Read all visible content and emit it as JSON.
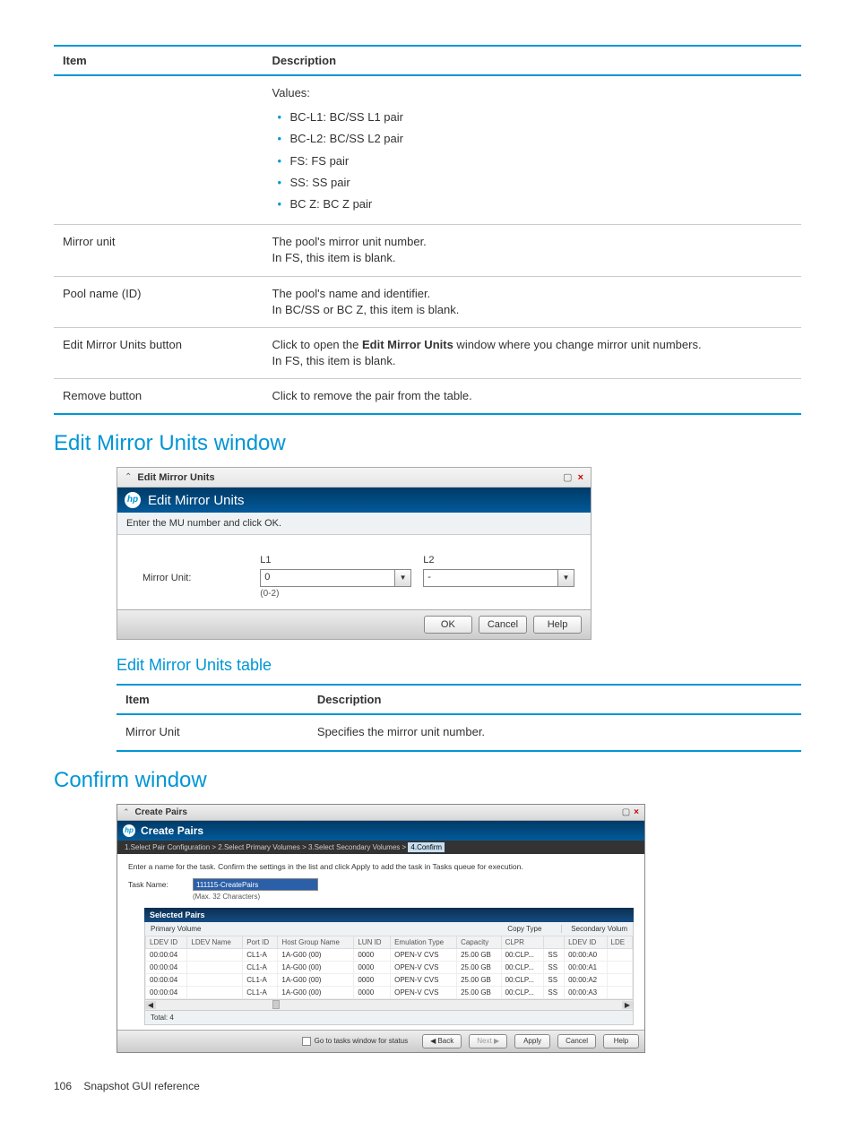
{
  "table1": {
    "headers": {
      "item": "Item",
      "desc": "Description"
    },
    "rows": {
      "r0": {
        "item": "",
        "values_label": "Values:",
        "bullets": [
          "BC-L1: BC/SS L1 pair",
          "BC-L2: BC/SS L2 pair",
          "FS: FS pair",
          "SS: SS pair",
          "BC Z: BC Z pair"
        ]
      },
      "r1": {
        "item": "Mirror unit",
        "l1": "The pool's mirror unit number.",
        "l2": "In FS, this item is blank."
      },
      "r2": {
        "item": "Pool name (ID)",
        "l1": "The pool's name and identifier.",
        "l2": "In BC/SS or BC Z, this item is blank."
      },
      "r3": {
        "item": "Edit Mirror Units button",
        "p1a": "Click to open the ",
        "p1b": "Edit Mirror Units",
        "p1c": " window where you change mirror unit numbers.",
        "l2": "In FS, this item is blank."
      },
      "r4": {
        "item": "Remove button",
        "l1": "Click to remove the pair from the table."
      }
    }
  },
  "h2_emu": "Edit Mirror Units window",
  "win1": {
    "bar_title": "Edit Mirror Units",
    "banner": "Edit Mirror Units",
    "sub": "Enter the MU number and click OK.",
    "label": "Mirror Unit:",
    "L1": {
      "h": "L1",
      "val": "0",
      "range": "(0-2)"
    },
    "L2": {
      "h": "L2",
      "val": "-"
    },
    "ok": "OK",
    "cancel": "Cancel",
    "help": "Help"
  },
  "h3_emu_table": "Edit Mirror Units table",
  "table2": {
    "headers": {
      "item": "Item",
      "desc": "Description"
    },
    "rows": {
      "r0": {
        "item": "Mirror Unit",
        "desc": "Specifies the mirror unit number."
      }
    }
  },
  "h2_confirm": "Confirm window",
  "win2": {
    "bar_title": "Create Pairs",
    "banner": "Create Pairs",
    "crumb": "1.Select Pair Configuration   >   2.Select Primary Volumes   >   3.Select Secondary Volumes   >   ",
    "crumb_active": "4.Confirm",
    "msg": "Enter a name for the task. Confirm the settings in the list and click Apply to add the task in Tasks queue for execution.",
    "taskname_label": "Task Name:",
    "taskname_value": "111115-CreatePairs",
    "taskname_hint": "(Max. 32 Characters)",
    "section": "Selected Pairs",
    "pv_left": "Primary Volume",
    "copytype": "Copy Type",
    "pv_right": "Secondary Volum",
    "cols": {
      "ldev": "LDEV ID",
      "ldevname": "LDEV Name",
      "port": "Port ID",
      "hg": "Host Group Name",
      "lun": "LUN ID",
      "emu": "Emulation Type",
      "cap": "Capacity",
      "clpr": "CLPR",
      "ct": "SS",
      "sldev": "LDEV ID",
      "slde": "LDE"
    },
    "rows": [
      {
        "ldev": "00:00:04",
        "ldevname": "",
        "port": "CL1-A",
        "hg": "1A-G00 (00)",
        "lun": "0000",
        "emu": "OPEN-V CVS",
        "cap": "25.00 GB",
        "clpr": "00:CLP...",
        "ct": "SS",
        "sldev": "00:00:A0"
      },
      {
        "ldev": "00:00:04",
        "ldevname": "",
        "port": "CL1-A",
        "hg": "1A-G00 (00)",
        "lun": "0000",
        "emu": "OPEN-V CVS",
        "cap": "25.00 GB",
        "clpr": "00:CLP...",
        "ct": "SS",
        "sldev": "00:00:A1"
      },
      {
        "ldev": "00:00:04",
        "ldevname": "",
        "port": "CL1-A",
        "hg": "1A-G00 (00)",
        "lun": "0000",
        "emu": "OPEN-V CVS",
        "cap": "25.00 GB",
        "clpr": "00:CLP...",
        "ct": "SS",
        "sldev": "00:00:A2"
      },
      {
        "ldev": "00:00:04",
        "ldevname": "",
        "port": "CL1-A",
        "hg": "1A-G00 (00)",
        "lun": "0000",
        "emu": "OPEN-V CVS",
        "cap": "25.00 GB",
        "clpr": "00:CLP...",
        "ct": "SS",
        "sldev": "00:00:A3"
      }
    ],
    "total": "Total: 4",
    "chk": "Go to tasks window for status",
    "back": "◀ Back",
    "next": "Next ▶",
    "apply": "Apply",
    "cancel": "Cancel",
    "help": "Help"
  },
  "footer": {
    "page": "106",
    "title": "Snapshot GUI reference"
  }
}
